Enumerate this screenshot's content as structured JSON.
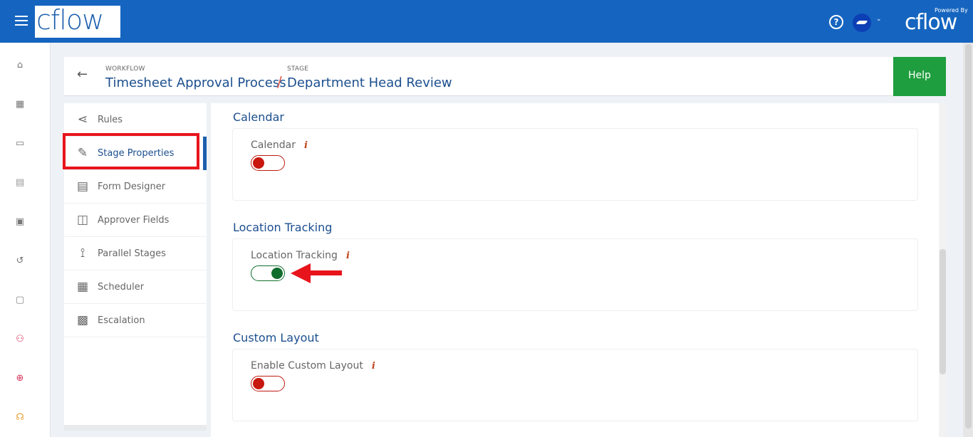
{
  "topbar": {
    "logo": "cflow",
    "powered_by": "Powered By",
    "powered_logo": "cflow",
    "help_icon": "?",
    "avatar_caret": "⌄"
  },
  "rail": {
    "items": [
      {
        "name": "home",
        "glyph": "⌂",
        "color": "#777777"
      },
      {
        "name": "apps",
        "glyph": "▦",
        "color": "#777777"
      },
      {
        "name": "calendar",
        "glyph": "▭",
        "color": "#777777"
      },
      {
        "name": "gallery",
        "glyph": "▤",
        "color": "#999999"
      },
      {
        "name": "documents",
        "glyph": "▣",
        "color": "#777777"
      },
      {
        "name": "history",
        "glyph": "↺",
        "color": "#777777"
      },
      {
        "name": "reports",
        "glyph": "▢",
        "color": "#888888"
      },
      {
        "name": "org-chart",
        "glyph": "⚇",
        "color": "#d6335a"
      },
      {
        "name": "target",
        "glyph": "⊕",
        "color": "#d6335a"
      },
      {
        "name": "support",
        "glyph": "☊",
        "color": "#e8a33a"
      }
    ]
  },
  "header": {
    "back": "←",
    "workflow_label": "WORKFLOW",
    "workflow_title": "Timesheet Approval Process",
    "separator": "/",
    "stage_label": "STAGE",
    "stage_title": "Department Head Review",
    "help_button": "Help"
  },
  "side_menu": {
    "items": [
      {
        "label": "Rules",
        "icon": "share-icon",
        "glyph": "⋖",
        "active": false
      },
      {
        "label": "Stage Properties",
        "icon": "edit-icon",
        "glyph": "✎",
        "active": true
      },
      {
        "label": "Form Designer",
        "icon": "form-icon",
        "glyph": "▤",
        "active": false
      },
      {
        "label": "Approver Fields",
        "icon": "approver-icon",
        "glyph": "◫",
        "active": false
      },
      {
        "label": "Parallel Stages",
        "icon": "parallel-icon",
        "glyph": "⟟",
        "active": false
      },
      {
        "label": "Scheduler",
        "icon": "scheduler-icon",
        "glyph": "▦",
        "active": false
      },
      {
        "label": "Escalation",
        "icon": "escalation-icon",
        "glyph": "▩",
        "active": false
      }
    ]
  },
  "sections": [
    {
      "title": "Calendar",
      "field_label": "Calendar",
      "info": "i",
      "enabled": false
    },
    {
      "title": "Location Tracking",
      "field_label": "Location Tracking",
      "info": "i",
      "enabled": true
    },
    {
      "title": "Custom Layout",
      "field_label": "Enable Custom Layout",
      "info": "i",
      "enabled": false
    }
  ],
  "colors": {
    "topbar": "#1565c0",
    "accent_text": "#1c4f8f",
    "help_button": "#1e9e3e",
    "toggle_off": "#c7170e",
    "toggle_on": "#0f6d2e",
    "annotation_red": "#e8141c"
  }
}
